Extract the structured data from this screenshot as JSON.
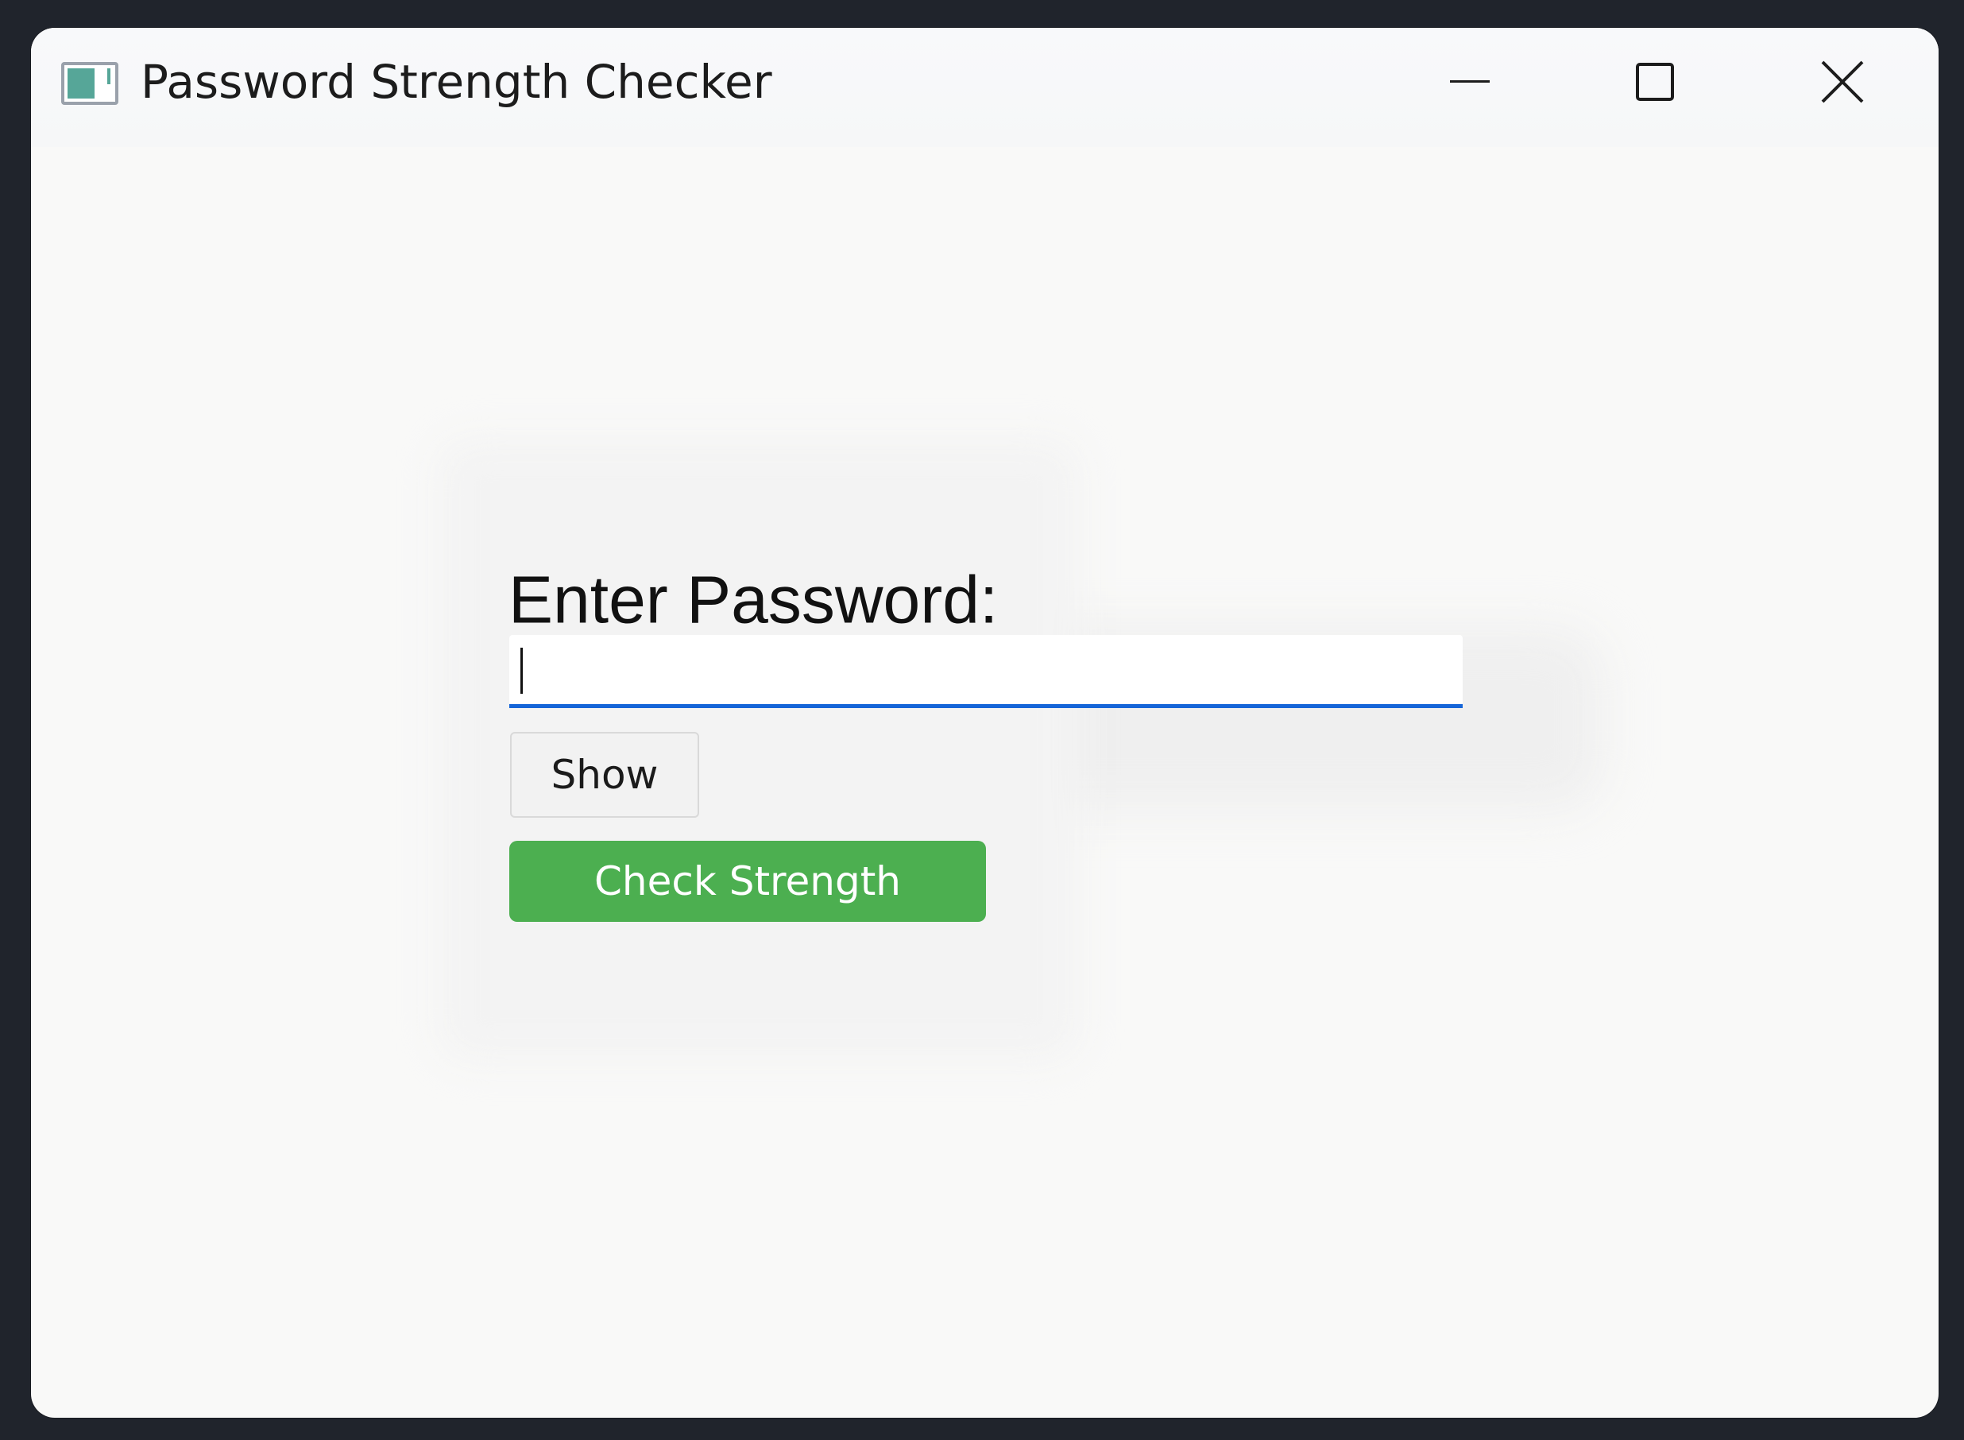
{
  "window": {
    "title": "Password Strength Checker",
    "app_icon": "window-app-icon",
    "controls": {
      "minimize_icon": "minimize-icon",
      "maximize_icon": "maximize-icon",
      "close_icon": "close-icon"
    }
  },
  "form": {
    "label": "Enter Password:",
    "password_value": "",
    "show_label": "Show",
    "check_label": "Check Strength"
  },
  "colors": {
    "accent_underline": "#1565d8",
    "check_button": "#4caf50",
    "app_icon": "#56a698"
  }
}
